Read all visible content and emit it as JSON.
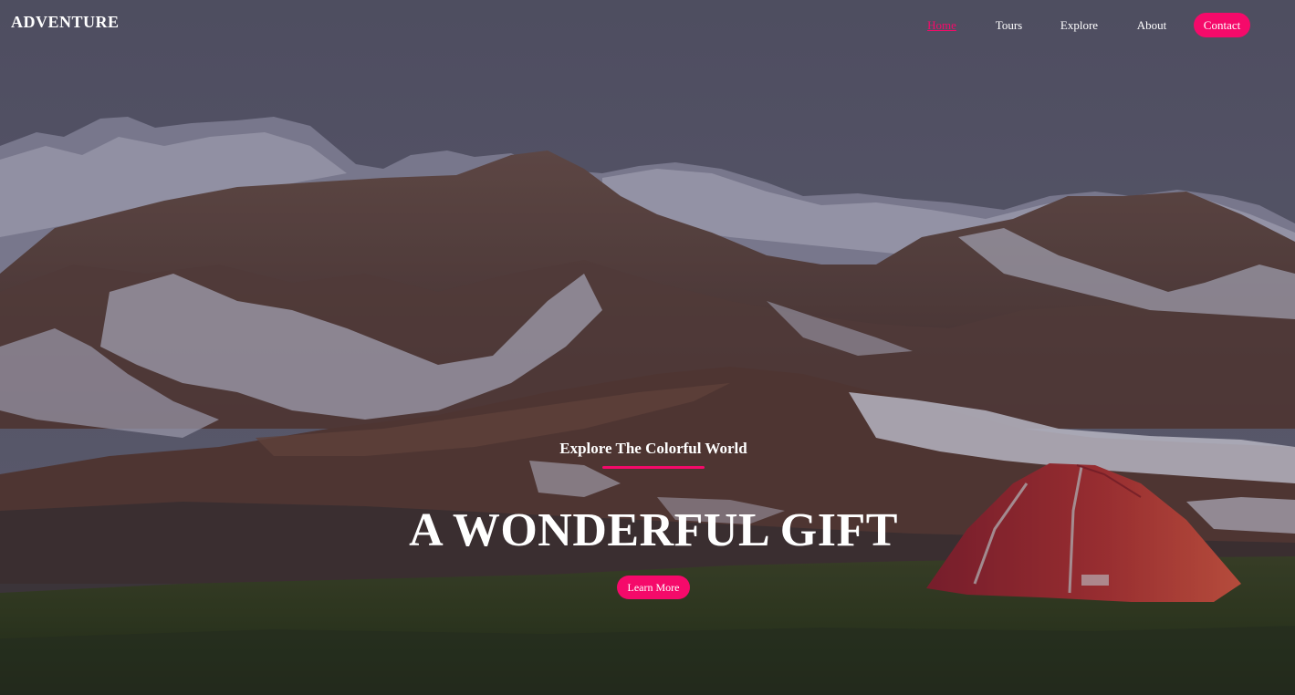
{
  "brand": {
    "logo_text": "ADVENTURE"
  },
  "nav": {
    "items": [
      {
        "label": "Home",
        "active": true
      },
      {
        "label": "Tours",
        "active": false
      },
      {
        "label": "Explore",
        "active": false
      },
      {
        "label": "About",
        "active": false
      }
    ],
    "contact_label": "Contact"
  },
  "hero": {
    "subtitle": "Explore The Colorful World",
    "headline": "A WONDERFUL GIFT",
    "cta_label": "Learn More",
    "background_scene": "mountain-camping-landscape"
  },
  "colors": {
    "accent": "#f50a6a",
    "text": "#ffffff",
    "sky": "#5c5b6e"
  }
}
